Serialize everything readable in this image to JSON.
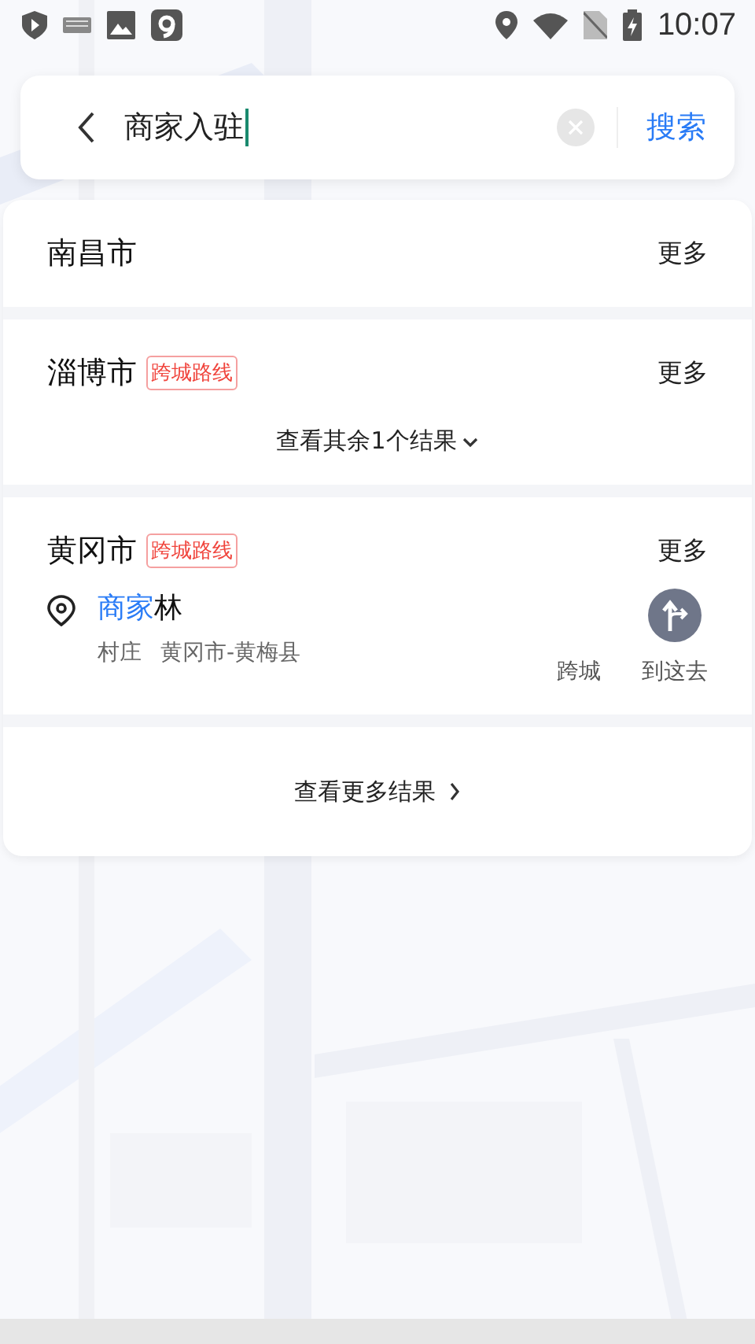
{
  "status_bar": {
    "time": "10:07"
  },
  "search": {
    "value": "商家入驻",
    "button": "搜索"
  },
  "groups": [
    {
      "city": "南昌市",
      "more": "更多"
    },
    {
      "city": "淄博市",
      "tag": "跨城路线",
      "more": "更多",
      "expand": "查看其余1个结果"
    },
    {
      "city": "黄冈市",
      "tag": "跨城路线",
      "more": "更多",
      "results": [
        {
          "name_parts": [
            {
              "text": "商家",
              "matched": true
            },
            {
              "text": "林",
              "matched": false
            }
          ],
          "type": "村庄",
          "region": "黄冈市-黄梅县",
          "actions": [
            "跨城",
            "到这去"
          ]
        }
      ]
    }
  ],
  "footer": {
    "label": "查看更多结果"
  }
}
